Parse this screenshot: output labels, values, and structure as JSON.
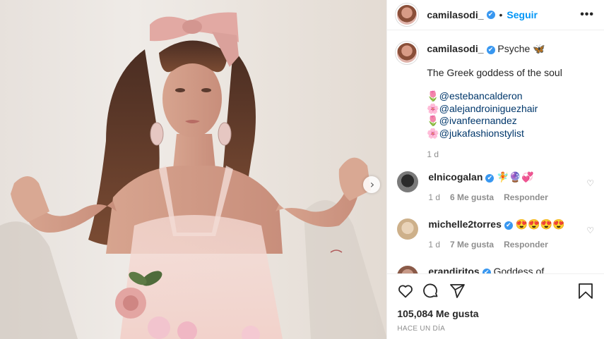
{
  "post": {
    "author": "camilasodi_",
    "follow_label": "Seguir",
    "separator": "•",
    "more_label": "•••",
    "verified_mark": "✔",
    "caption_title": "Psyche 🦋",
    "caption_text": "The Greek goddess of the soul",
    "mentions": [
      {
        "emoji": "🌷",
        "handle": "@estebancalderon"
      },
      {
        "emoji": "🌸",
        "handle": "@alejandroiniguezhair"
      },
      {
        "emoji": "🌷",
        "handle": "@ivanfeernandez"
      },
      {
        "emoji": "🌸",
        "handle": "@jukafashionstylist"
      }
    ],
    "caption_age": "1 d"
  },
  "comments": [
    {
      "user": "elnicogalan",
      "text": "🧚🔮💞",
      "age": "1 d",
      "likes": "6 Me gusta",
      "reply": "Responder"
    },
    {
      "user": "michelle2torres",
      "text": "😍😍😍😍",
      "age": "1 d",
      "likes": "7 Me gusta",
      "reply": "Responder"
    },
    {
      "user": "erandiritos",
      "text": "Goddess of"
    }
  ],
  "footer": {
    "likes": "105,084 Me gusta",
    "time": "HACE UN DÍA"
  },
  "icons": {
    "next": "chevron-right-icon",
    "like": "heart-icon",
    "comment": "comment-icon",
    "share": "share-icon",
    "save": "bookmark-icon"
  },
  "colors": {
    "accent": "#0095f6",
    "verified": "#3897f0",
    "mention": "#00376b",
    "muted": "#8e8e8e"
  }
}
